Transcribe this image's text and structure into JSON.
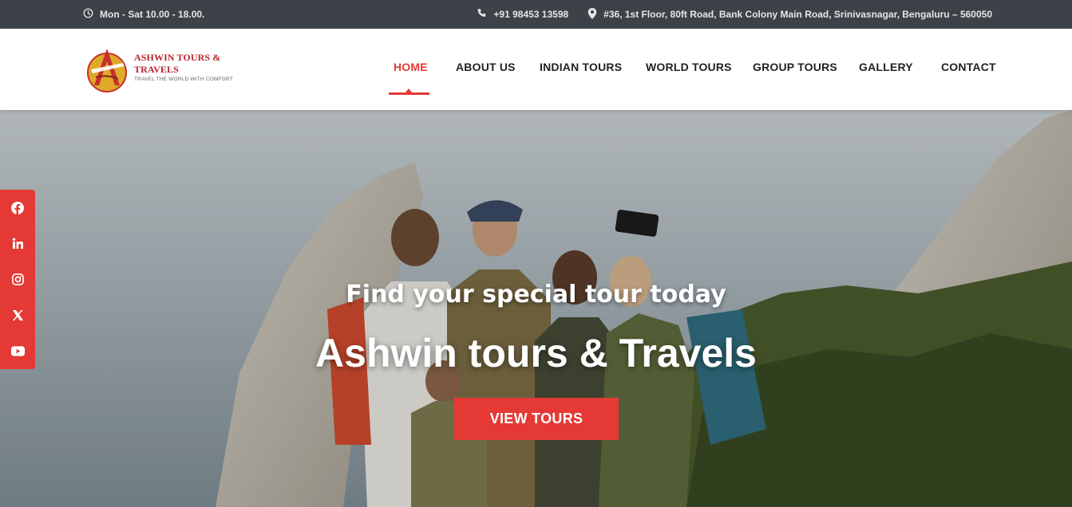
{
  "topbar": {
    "hours": "Mon - Sat 10.00 - 18.00.",
    "phone": "+91 98453 13598",
    "address": "#36, 1st Floor, 80ft Road, Bank Colony Main Road, Srinivasnagar, Bengaluru – 560050",
    "icons": [
      "clock-icon",
      "phone-icon",
      "map-pin-icon"
    ]
  },
  "header": {
    "logo_title": "ASHWIN TOURS & TRAVELS",
    "logo_tagline": "TRAVEL THE WORLD WITH COMFORT",
    "nav": [
      {
        "label": "HOME",
        "active": true
      },
      {
        "label": "ABOUT US",
        "active": false
      },
      {
        "label": "INDIAN TOURS",
        "active": false
      },
      {
        "label": "WORLD TOURS",
        "active": false
      },
      {
        "label": "GROUP TOURS",
        "active": false
      },
      {
        "label": "GALLERY",
        "active": false
      },
      {
        "label": "CONTACT",
        "active": false
      }
    ]
  },
  "hero": {
    "subtitle": "Find your special tour today",
    "title": "Ashwin tours & Travels",
    "button_label": "VIEW TOURS"
  },
  "social": [
    "facebook-icon",
    "linkedin-icon",
    "instagram-icon",
    "x-icon",
    "youtube-icon"
  ],
  "colors": {
    "accent": "#e53935",
    "topbar_bg": "#3c4248",
    "nav_text": "#222222"
  }
}
